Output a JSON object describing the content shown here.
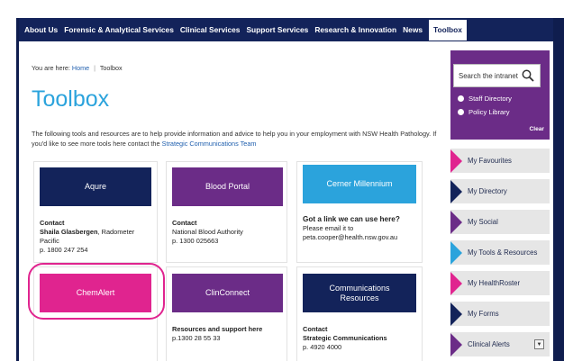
{
  "nav": {
    "items": [
      "About Us",
      "Forensic & Analytical Services",
      "Clinical Services",
      "Support Services",
      "Research & Innovation",
      "News",
      "Toolbox"
    ],
    "active": "Toolbox"
  },
  "breadcrumb": {
    "prefix": "You are here:",
    "home": "Home",
    "current": "Toolbox"
  },
  "page": {
    "title": "Toolbox",
    "intro_text": "The following tools and resources are to help provide information and advice to help you in your employment with NSW Health Pathology.  If you'd like to see more tools here contact the",
    "intro_link": "Strategic Communications Team"
  },
  "cards": [
    {
      "tile": "Aqure",
      "color": "#13235a",
      "lines": [
        {
          "text": "Contact",
          "bold": true
        },
        {
          "text": "Shaila Glasbergen",
          "bold": true,
          "suffix": ", Radometer"
        },
        {
          "text": "Pacific"
        },
        {
          "text": "p. 1800 247 254"
        }
      ]
    },
    {
      "tile": "Blood Portal",
      "color": "#6b2c87",
      "lines": [
        {
          "text": "Contact",
          "bold": true
        },
        {
          "text": "National Blood Authority"
        },
        {
          "text": "p. 1300 025663"
        }
      ]
    },
    {
      "tile": "Cerner Millennium",
      "color": "#2ba3dc",
      "lines": [
        {
          "text": "Got a link we can use here?",
          "bold": true
        },
        {
          "text": "Please email it to"
        },
        {
          "text": "peta.cooper@health.nsw.gov.au"
        }
      ]
    },
    {
      "tile": "ChemAlert",
      "color": "#e0248f",
      "lines": []
    },
    {
      "tile": "ClinConnect",
      "color": "#6b2c87",
      "lines": [
        {
          "text": "Resources and support here",
          "bold": true
        },
        {
          "text": "p.1300 28 55 33"
        }
      ]
    },
    {
      "tile": "Communications Resources",
      "color": "#13235a",
      "lines": [
        {
          "text": "Contact",
          "bold": true
        },
        {
          "text": "Strategic Communications",
          "bold": true
        },
        {
          "text": "p. 4920 4000"
        }
      ]
    }
  ],
  "sidebar": {
    "search_placeholder": "Search the intranet",
    "radios": [
      "Staff Directory",
      "Policy Library"
    ],
    "clear": "Clear",
    "links": [
      {
        "label": "My Favourites",
        "arrow": "#e0248f"
      },
      {
        "label": "My Directory",
        "arrow": "#13235a"
      },
      {
        "label": "My Social",
        "arrow": "#6b2c87"
      },
      {
        "label": "My Tools & Resources",
        "arrow": "#2ba3dc"
      },
      {
        "label": "My HealthRoster",
        "arrow": "#e0248f"
      },
      {
        "label": "My Forms",
        "arrow": "#13235a"
      },
      {
        "label": "Clinical Alerts",
        "arrow": "#6b2c87",
        "dropdown": true
      }
    ]
  },
  "colors": {
    "navy": "#13235a",
    "purple": "#6b2c87",
    "pink": "#e0248f",
    "cyan": "#2ba3dc"
  }
}
